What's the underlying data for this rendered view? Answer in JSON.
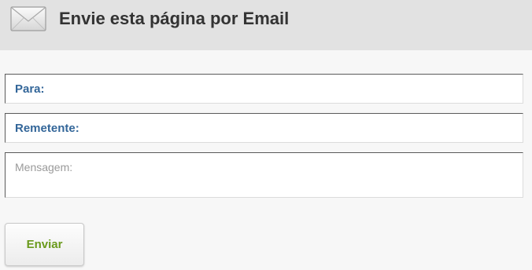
{
  "header": {
    "icon": "envelope-icon",
    "title": "Envie esta página por Email"
  },
  "form": {
    "to": {
      "label": "Para:",
      "value": ""
    },
    "sender": {
      "label": "Remetente:",
      "value": ""
    },
    "message": {
      "placeholder": "Mensagem:",
      "value": ""
    },
    "submit_label": "Enviar"
  },
  "colors": {
    "header_background": "#e2e2e2",
    "page_background": "#f7f7f7",
    "label_blue": "#336699",
    "button_text_green": "#6a9a1c",
    "title_text": "#333333"
  }
}
